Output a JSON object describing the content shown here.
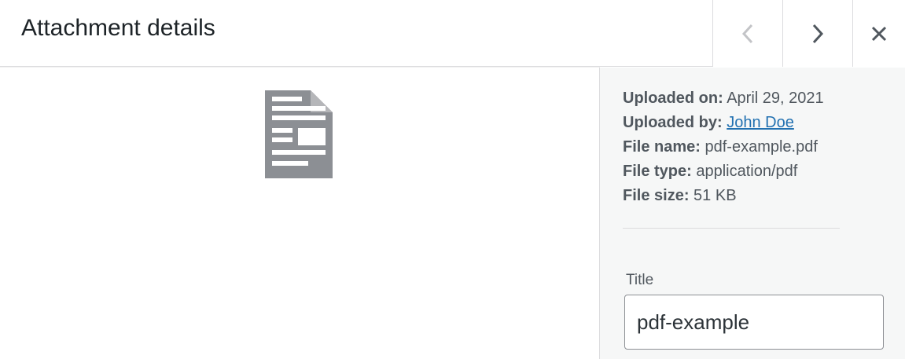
{
  "header": {
    "title": "Attachment details"
  },
  "icons": {
    "prev": "chevron-left-icon",
    "next": "chevron-right-icon",
    "close": "close-icon",
    "document": "document-icon"
  },
  "details": {
    "uploaded_on_label": "Uploaded on:",
    "uploaded_on_value": "April 29, 2021",
    "uploaded_by_label": "Uploaded by:",
    "uploaded_by_value": "John Doe",
    "file_name_label": "File name:",
    "file_name_value": "pdf-example.pdf",
    "file_type_label": "File type:",
    "file_type_value": "application/pdf",
    "file_size_label": "File size:",
    "file_size_value": "51 KB"
  },
  "form": {
    "title_label": "Title",
    "title_value": "pdf-example"
  },
  "colors": {
    "link": "#2271b1",
    "sidebar_bg": "#f6f7f7",
    "icon_gray": "#8c8f94"
  }
}
